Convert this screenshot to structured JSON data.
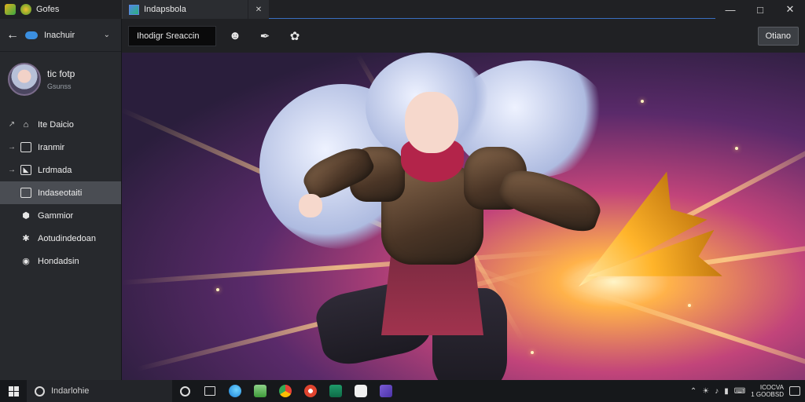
{
  "titlebar": {
    "app_name": "Gofes",
    "tab_title": "Indapsbola",
    "tab_close": "✕",
    "minimize": "—",
    "maximize": "□",
    "close": "✕"
  },
  "sidebar": {
    "header_label": "Inachuir",
    "profile_name": "tic fotp",
    "profile_sub": "Gsunss",
    "items": [
      {
        "label": "Ite Daicio",
        "icon": "home-icon",
        "glyph": "⌂",
        "arrow": "↗",
        "active": false
      },
      {
        "label": "Iranmir",
        "icon": "document-icon",
        "glyph": "",
        "arrow": "→",
        "active": false
      },
      {
        "label": "Lrdmada",
        "icon": "image-icon",
        "glyph": "◣",
        "arrow": "→",
        "active": false
      },
      {
        "label": "Indaseotaiti",
        "icon": "picture-icon",
        "glyph": "",
        "arrow": "",
        "active": true
      },
      {
        "label": "Gammior",
        "icon": "shield-icon",
        "glyph": "⬢",
        "arrow": "",
        "active": false
      },
      {
        "label": "Aotudindedoan",
        "icon": "settings-icon",
        "glyph": "✱",
        "arrow": "",
        "active": false
      },
      {
        "label": "Hondadsin",
        "icon": "record-icon",
        "glyph": "◉",
        "arrow": "",
        "active": false
      }
    ]
  },
  "toolbar": {
    "search_value": "Ihodigr Sreaccin",
    "open_label": "Otiano"
  },
  "taskbar": {
    "search_text": "Indarlohie",
    "clock_line1": "ICOCVA",
    "clock_line2": "1 GOOBSD"
  },
  "colors": {
    "accent": "#3b8fe0",
    "sidebar_bg": "#27292d",
    "active_item": "#4a4d53"
  }
}
